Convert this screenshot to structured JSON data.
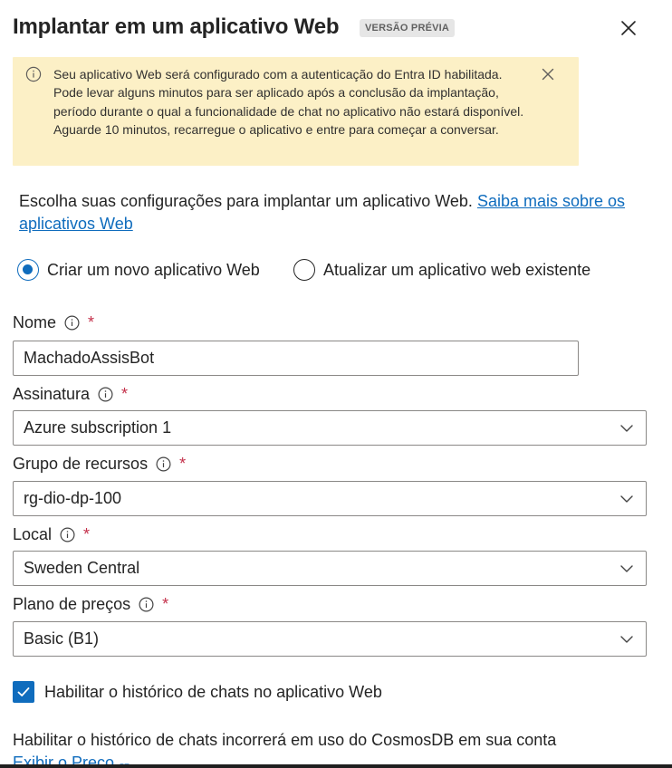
{
  "panel": {
    "title": "Implantar em um aplicativo Web",
    "badge": "VERSÃO PRÉVIA"
  },
  "banner": {
    "message": "Seu aplicativo Web será configurado com a autenticação do Entra ID habilitada. Pode levar alguns minutos para ser aplicado após a conclusão da implantação, período durante o qual a funcionalidade de chat no aplicativo não estará disponível. Aguarde 10 minutos, recarregue o aplicativo e entre para começar a conversar."
  },
  "intro": {
    "text": "Escolha suas configurações para implantar um aplicativo Web. ",
    "link": "Saiba mais sobre os aplicativos Web"
  },
  "deploy_mode": {
    "options": [
      {
        "label": "Criar um novo aplicativo Web",
        "selected": true
      },
      {
        "label": "Atualizar um aplicativo web existente",
        "selected": false
      }
    ]
  },
  "form": {
    "name": {
      "label": "Nome",
      "value": "MachadoAssisBot"
    },
    "subscription": {
      "label": "Assinatura",
      "value": "Azure subscription 1"
    },
    "resource_group": {
      "label": "Grupo de recursos",
      "value": "rg-dio-dp-100"
    },
    "location": {
      "label": "Local",
      "value": "Sweden Central"
    },
    "pricing_plan": {
      "label": "Plano de preços",
      "value": "Basic (B1)"
    },
    "required_mark": "*"
  },
  "chat_history": {
    "label": "Habilitar o histórico de chats no aplicativo Web",
    "checked": true
  },
  "footer": {
    "text": "Habilitar o histórico de chats incorrerá em uso do CosmosDB em sua conta ",
    "link": "Exibir o Preço"
  },
  "colors": {
    "accent": "#0f6cbd",
    "banner_bg": "#fcf0c6",
    "required": "#c4314b"
  }
}
